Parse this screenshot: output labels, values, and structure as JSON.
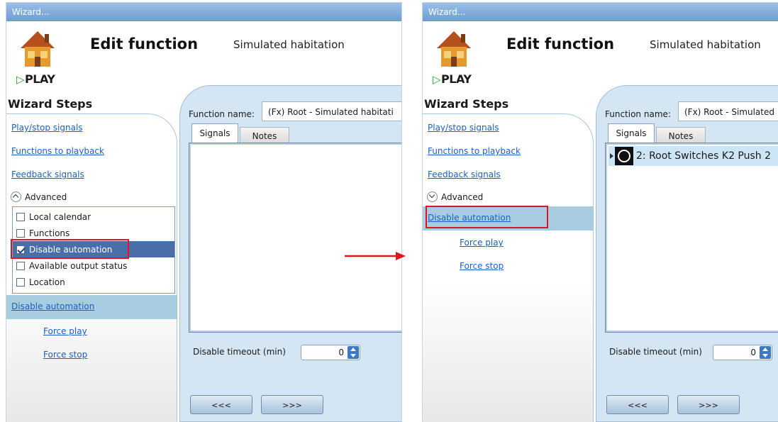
{
  "before": {
    "window_title": "Wizard...",
    "header": {
      "title": "Edit function",
      "subtitle": "Simulated habitation",
      "logo_text": "PLAY"
    },
    "wizard_steps": {
      "title": "Wizard Steps",
      "links": [
        "Play/stop signals",
        "Functions to playback",
        "Feedback signals"
      ],
      "advanced_label": "Advanced",
      "options": [
        {
          "label": "Local calendar",
          "checked": false
        },
        {
          "label": "Functions",
          "checked": false
        },
        {
          "label": "Disable automation",
          "checked": true
        },
        {
          "label": "Available output status",
          "checked": false
        },
        {
          "label": "Location",
          "checked": false
        }
      ],
      "selected_step": "Disable automation",
      "sub_steps": [
        "Force play",
        "Force stop"
      ]
    },
    "content": {
      "function_name_label": "Function name:",
      "function_name_value": "(Fx) Root - Simulated habitati",
      "tabs": [
        "Signals",
        "Notes"
      ],
      "active_tab": "Signals",
      "signals": [],
      "timeout_label": "Disable timeout (min)",
      "timeout_value": "0",
      "prev_button": "<<<",
      "next_button": ">>>"
    }
  },
  "after": {
    "window_title": "Wizard...",
    "header": {
      "title": "Edit function",
      "subtitle": "Simulated habitation",
      "logo_text": "PLAY"
    },
    "wizard_steps": {
      "title": "Wizard Steps",
      "links": [
        "Play/stop signals",
        "Functions to playback",
        "Feedback signals"
      ],
      "advanced_label": "Advanced",
      "selected_step": "Disable automation",
      "sub_steps": [
        "Force play",
        "Force stop"
      ]
    },
    "content": {
      "function_name_label": "Function name:",
      "function_name_value": "(Fx) Root - Simulated",
      "tabs": [
        "Signals",
        "Notes"
      ],
      "active_tab": "Signals",
      "signals": [
        "2: Root Switches K2 Push 2"
      ],
      "timeout_label": "Disable timeout (min)",
      "timeout_value": "0",
      "prev_button": "<<<",
      "next_button": ">>>"
    }
  },
  "colors": {
    "highlight_box": "#e0141c",
    "arrow": "#e0141c",
    "link": "#1a5fc8",
    "content_bg": "#d4e6f3",
    "selection": "#a9cde0"
  }
}
